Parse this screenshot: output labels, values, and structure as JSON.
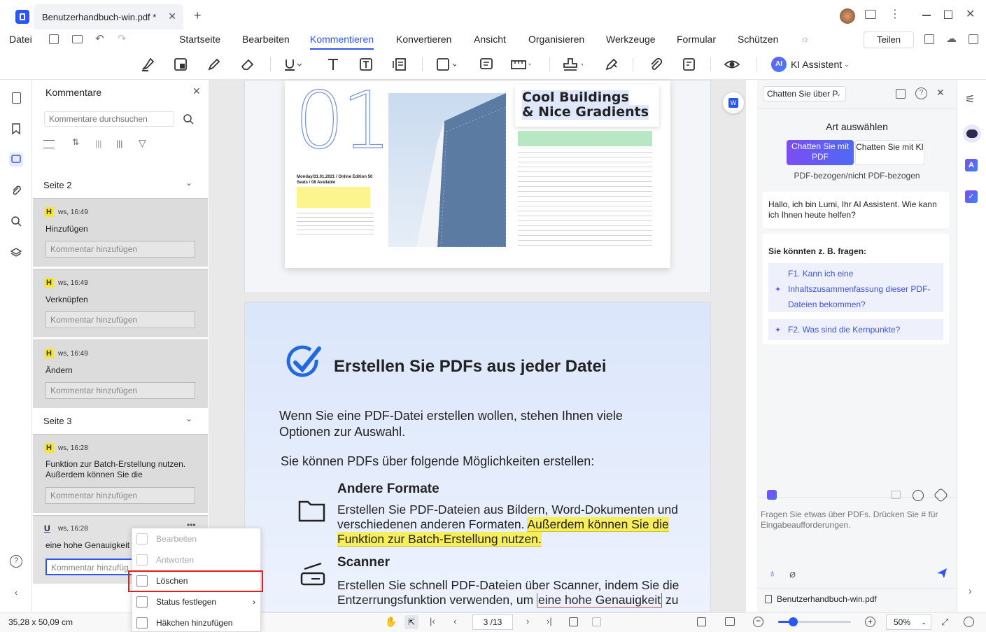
{
  "window": {
    "tab_title": "Benutzerhandbuch-win.pdf *",
    "file_menu": "Datei"
  },
  "menu": [
    "Startseite",
    "Bearbeiten",
    "Kommentieren",
    "Konvertieren",
    "Ansicht",
    "Organisieren",
    "Werkzeuge",
    "Formular",
    "Schützen"
  ],
  "share_label": "Teilen",
  "ai_label": "KI Assistent",
  "comments": {
    "title": "Kommentare",
    "search_placeholder": "Kommentare durchsuchen",
    "sections": [
      {
        "label": "Seite 2"
      },
      {
        "label": "Seite 3"
      }
    ],
    "items": [
      {
        "badge": "H",
        "meta": "ws, 16:49",
        "text": "Hinzufügen",
        "input": "Kommentar hinzufügen"
      },
      {
        "badge": "H",
        "meta": "ws, 16:49",
        "text": "Verknüpfen",
        "input": "Kommentar hinzufügen"
      },
      {
        "badge": "H",
        "meta": "ws, 16:49",
        "text": "Ändern",
        "input": "Kommentar hinzufügen"
      },
      {
        "badge": "H",
        "meta": "ws, 16:28",
        "text": "Funktion zur Batch-Erstellung nutzen. Außerdem können Sie die",
        "input": "Kommentar hinzufügen"
      },
      {
        "badge": "U",
        "meta": "ws, 16:28",
        "text": "eine hohe Genauigkeit",
        "input": "Kommentar hinzufüg"
      }
    ]
  },
  "context_menu": [
    "Bearbeiten",
    "Antworten",
    "Löschen",
    "Status festlegen",
    "Häkchen hinzufügen"
  ],
  "doc": {
    "p1_title1": "Cool Buildings",
    "p1_title2": "& Nice Gradients",
    "p1_big": "01",
    "p1_meta": "Monday/31.01.2021 / Online Edition 50 Seats / 08 Available",
    "p2_heading": "Erstellen Sie PDFs aus jeder Datei",
    "p2_para1": "Wenn Sie eine PDF-Datei erstellen wollen, stehen Ihnen viele Optionen zur Auswahl.",
    "p2_para2": "Sie können PDFs über folgende Möglichkeiten erstellen:",
    "p2_sub1": "Andere Formate",
    "p2_sub1_text_a": "Erstellen Sie PDF-Dateien aus Bildern, Word-Dokumenten und verschiedenen anderen Formaten. ",
    "p2_sub1_text_b": "Außerdem können Sie die Funktion zur Batch-Erstellung nutzen.",
    "p2_sub2": "Scanner",
    "p2_sub2_text_a": "Erstellen Sie schnell PDF-Dateien über Scanner, indem Sie die Entzerrungsfunktion verwenden, um ",
    "p2_sub2_text_b": "eine hohe Genauigkeit",
    "p2_sub2_text_c": " zu"
  },
  "ai": {
    "chat_dropdown": "Chatten Sie über P",
    "art_title": "Art auswählen",
    "opt1": "Chatten Sie mit PDF",
    "opt2": "Chatten Sie mit KI",
    "opt_sub": "PDF-bezogen/nicht PDF-bezogen",
    "greeting": "Hallo, ich bin Lumi, Ihr AI Assistent. Wie kann ich Ihnen heute helfen?",
    "ask_title": "Sie könnten z. B. fragen:",
    "q1": "F1. Kann ich eine Inhaltszusammenfassung dieser PDF-Dateien bekommen?",
    "q2": "F2. Was sind die Kernpunkte?",
    "input_placeholder": "Fragen Sie etwas über PDFs. Drücken Sie # für Eingabeaufforderungen.",
    "file": "Benutzerhandbuch-win.pdf"
  },
  "status": {
    "dims": "35,28 x 50,09 cm",
    "page": "3 /13",
    "zoom": "50%",
    "zoom_fraction": 0.2
  },
  "colors": {
    "accent": "#2c56f0",
    "highlight": "#f8e33a"
  }
}
